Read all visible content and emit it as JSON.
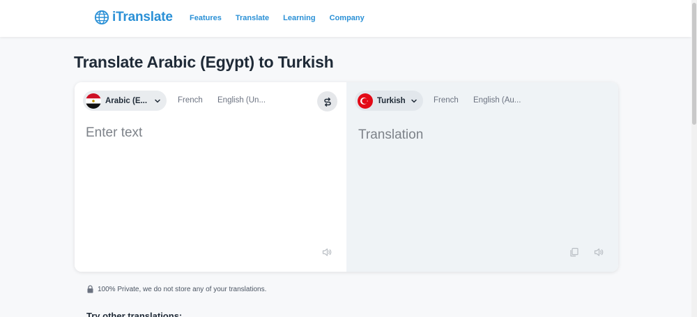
{
  "header": {
    "logo_text": "iTranslate",
    "nav": [
      "Features",
      "Translate",
      "Learning",
      "Company"
    ]
  },
  "page_title": "Translate Arabic (Egypt) to Turkish",
  "source": {
    "selected_label": "Arabic (E...",
    "options": [
      "French",
      "English (Un..."
    ],
    "placeholder": "Enter text",
    "icons": [
      "egypt-flag-icon",
      "chevron-down-icon",
      "speaker-icon"
    ]
  },
  "target": {
    "selected_label": "Turkish",
    "options": [
      "French",
      "English (Au..."
    ],
    "placeholder": "Translation",
    "icons": [
      "turkey-flag-icon",
      "chevron-down-icon",
      "copy-icon",
      "speaker-icon"
    ]
  },
  "privacy_note": "100% Private, we do not store any of your translations.",
  "other_translations_title": "Try other translations:",
  "colors": {
    "brand": "#2a90d6",
    "title": "#1f2a37",
    "muted": "#6b7280",
    "target_pane": "#eff3f6"
  }
}
